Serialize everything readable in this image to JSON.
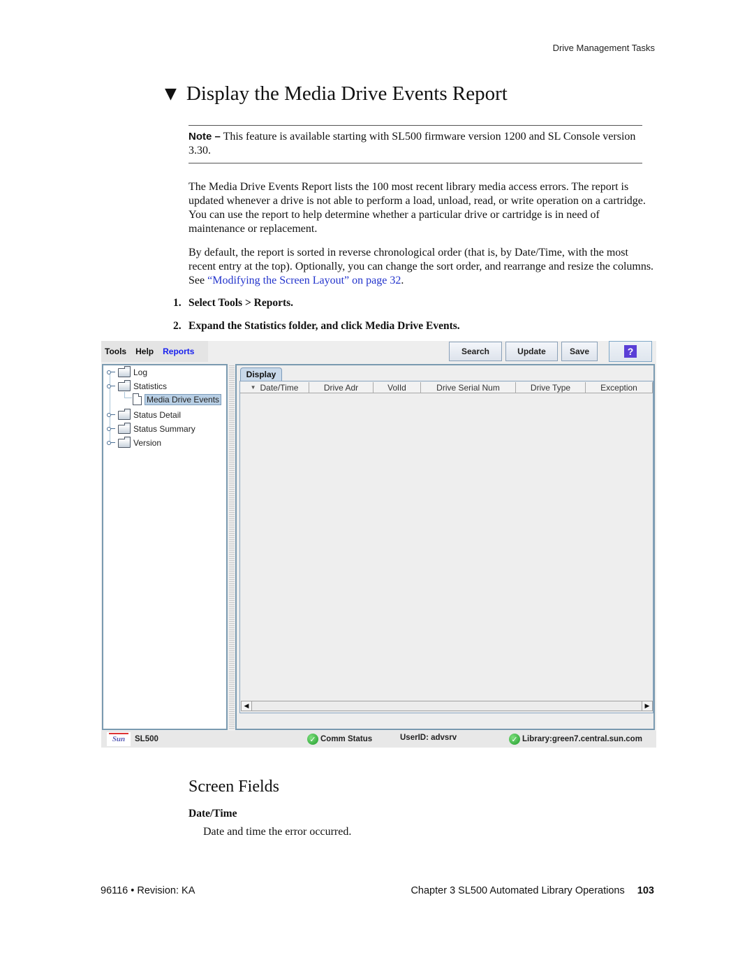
{
  "running_head": "Drive Management Tasks",
  "title": "Display the Media Drive Events Report",
  "note": {
    "label": "Note –",
    "text": "This feature is available starting with SL500 firmware version 1200 and SL Console version 3.30."
  },
  "paragraphs": [
    "The Media Drive Events Report lists the 100 most recent library media access errors. The report is updated whenever a drive is not able to perform a load, unload, read, or write operation on a cartridge. You can use the report to help determine whether a particular drive or cartridge is in need of maintenance or replacement.",
    "By default, the report is sorted in reverse chronological order (that is, by Date/Time, with the most recent entry at the top). Optionally, you can change the sort order, and rearrange and resize the columns. See "
  ],
  "cross_ref": {
    "text": "“Modifying the Screen Layout” on page 32",
    "after": "."
  },
  "steps": [
    {
      "num": "1.",
      "text": "Select Tools > Reports."
    },
    {
      "num": "2.",
      "text": "Expand the Statistics folder, and click Media Drive Events."
    }
  ],
  "app": {
    "menu": [
      "Tools",
      "Help",
      "Reports"
    ],
    "toolbar": {
      "search": "Search",
      "update": "Update",
      "save": "Save",
      "help": "?"
    },
    "tree": [
      {
        "label": "Log"
      },
      {
        "label": "Statistics"
      },
      {
        "label": "Media Drive Events",
        "selected": true
      },
      {
        "label": "Status Detail"
      },
      {
        "label": "Status Summary"
      },
      {
        "label": "Version"
      }
    ],
    "tab": "Display",
    "columns": [
      "Date/Time",
      "Drive Adr",
      "VolId",
      "Drive Serial Num",
      "Drive Type",
      "Exception"
    ],
    "scroll_left": "◀",
    "scroll_right": "▶",
    "status": {
      "product": "SL500",
      "logo": "Sun",
      "comm": "Comm Status",
      "user": "UserID: advsrv",
      "library": "Library:green7.central.sun.com"
    }
  },
  "section": {
    "heading": "Screen Fields",
    "field_label": "Date/Time",
    "field_desc": "Date and time the error occurred."
  },
  "footer": {
    "left": "96116 • Revision: KA",
    "chapter": "Chapter 3 SL500 Automated Library Operations",
    "page": "103"
  }
}
